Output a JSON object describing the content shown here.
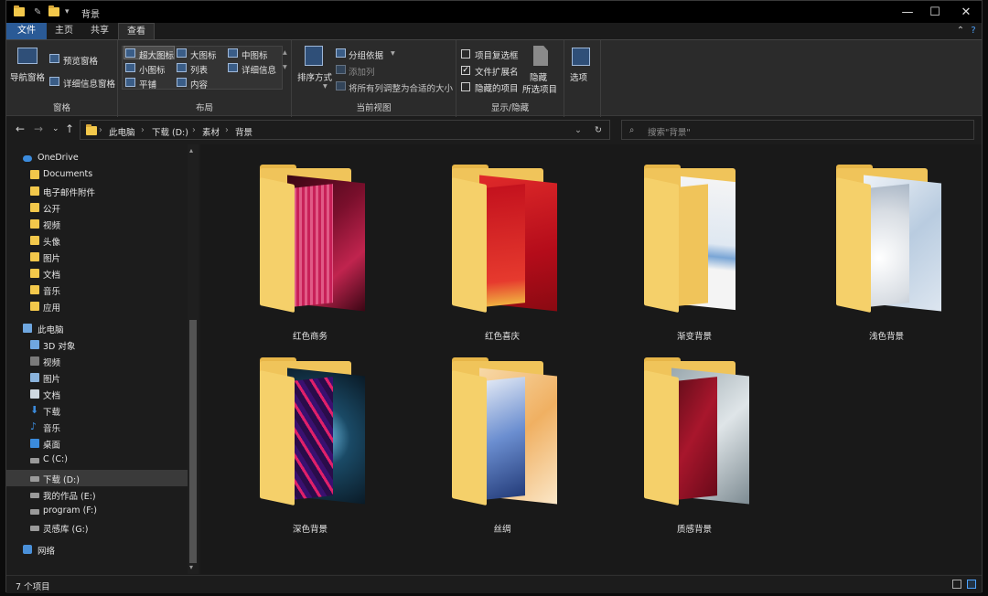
{
  "window": {
    "title": "背景",
    "min": "—",
    "max": "☐",
    "close": "✕"
  },
  "tabs": {
    "file": "文件",
    "home": "主页",
    "share": "共享",
    "view": "查看"
  },
  "ribbon": {
    "panes": {
      "nav_pane": "导航窗格",
      "preview_pane": "预览窗格",
      "details_pane": "详细信息窗格",
      "label": "窗格"
    },
    "layout": {
      "xl_icons": "超大图标",
      "large_icons": "大图标",
      "medium_icons": "中图标",
      "small_icons": "小图标",
      "list": "列表",
      "details": "详细信息",
      "tiles": "平铺",
      "content": "内容",
      "label": "布局"
    },
    "current_view": {
      "sort_by": "排序方式",
      "group_by": "分组依据",
      "add_column": "添加列",
      "fit_columns": "将所有列调整为合适的大小",
      "label": "当前视图"
    },
    "show_hide": {
      "item_checkboxes": "项目复选框",
      "file_ext": "文件扩展名",
      "hidden_items": "隐藏的项目",
      "hide_selected": "隐藏",
      "hide_selected2": "所选项目",
      "label": "显示/隐藏"
    },
    "options": "选项"
  },
  "address": {
    "crumbs": [
      "此电脑",
      "下载 (D:)",
      "素材",
      "背景"
    ],
    "search_placeholder": "搜索\"背景\""
  },
  "sidebar": {
    "onedrive": "OneDrive",
    "onedrive_items": [
      "Documents",
      "电子邮件附件",
      "公开",
      "视频",
      "头像",
      "图片",
      "文档",
      "音乐",
      "应用"
    ],
    "thispc": "此电脑",
    "pc_items": [
      "3D 对象",
      "视频",
      "图片",
      "文档",
      "下载",
      "音乐",
      "桌面",
      "C (C:)",
      "下载 (D:)",
      "我的作品 (E:)",
      "program (F:)",
      "灵感库 (G:)"
    ],
    "network": "网络"
  },
  "folders": [
    "红色商务",
    "红色喜庆",
    "渐变背景",
    "浅色背景",
    "深色背景",
    "丝绸",
    "质感背景"
  ],
  "status": {
    "count": "7 个项目"
  }
}
